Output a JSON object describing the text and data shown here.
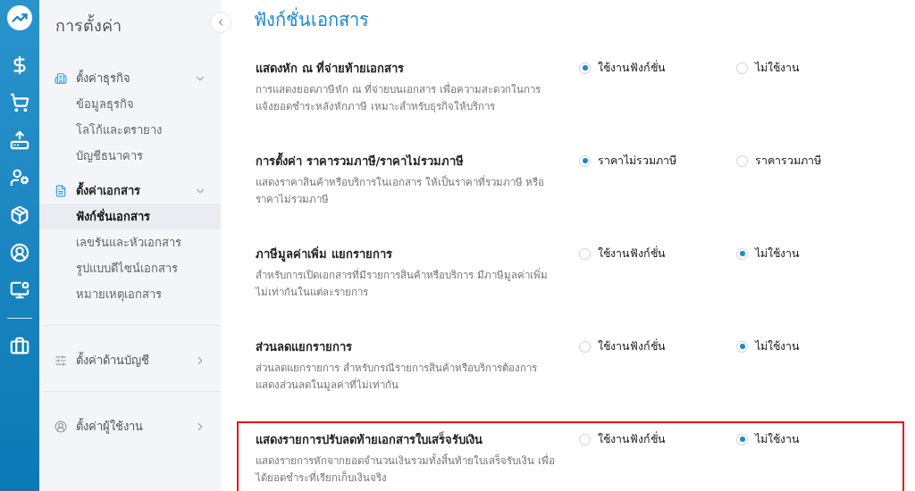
{
  "rail": {
    "items": [
      {
        "kind": "money"
      },
      {
        "kind": "cart"
      },
      {
        "kind": "upload"
      },
      {
        "kind": "contacts"
      },
      {
        "kind": "box"
      },
      {
        "kind": "user"
      },
      {
        "kind": "monitor"
      },
      {
        "kind": "divider"
      },
      {
        "kind": "briefcase"
      }
    ]
  },
  "sidebar": {
    "title": "การตั้งค่า",
    "groups": [
      {
        "label": "ตั้งค่าธุรกิจ",
        "kind": "building",
        "expanded": true,
        "children": [
          {
            "label": "ข้อมูลธุรกิจ",
            "selected": false
          },
          {
            "label": "โลโก้และตรายาง",
            "selected": false
          },
          {
            "label": "บัญชีธนาคาร",
            "selected": false
          }
        ]
      },
      {
        "label": "ตั้งค่าเอกสาร",
        "kind": "document",
        "expanded": true,
        "children": [
          {
            "label": "ฟังก์ชั่นเอกสาร",
            "selected": true
          },
          {
            "label": "เลขรันและหัวเอกสาร",
            "selected": false
          },
          {
            "label": "รูปแบบดีไซน์เอกสาร",
            "selected": false
          },
          {
            "label": "หมายเหตุเอกสาร",
            "selected": false
          }
        ]
      },
      {
        "label": "ตั้งค่าด้านบัญชี",
        "kind": "sliders",
        "expanded": false
      },
      {
        "label": "ตั้งค่าผู้ใช้งาน",
        "kind": "user",
        "expanded": false
      }
    ]
  },
  "page": {
    "title": "ฟังก์ชั่นเอกสาร",
    "settings": [
      {
        "title": "แสดงหัก ณ ที่จ่ายท้ายเอกสาร",
        "description": "การแสดงยอดภาษีหัก ณ ที่จ่ายบนเอกสาร เพื่อความสะดวกในการแจ้งยอดชำระหลังหักภาษี เหมาะสำหรับธุรกิจให้บริการ",
        "highlighted": false,
        "options": [
          {
            "label": "ใช้งานฟังก์ชั่น",
            "selected": true
          },
          {
            "label": "ไม่ใช้งาน",
            "selected": false
          }
        ]
      },
      {
        "title": "การตั้งค่า ราคารวมภาษี/ราคาไม่รวมภาษี",
        "description": "แสดงราคาสินค้าหรือบริการในเอกสาร ให้เป็นราคาที่รวมภาษี หรือราคาไม่รวมภาษี",
        "highlighted": false,
        "options": [
          {
            "label": "ราคาไม่รวมภาษี",
            "selected": true
          },
          {
            "label": "ราคารวมภาษี",
            "selected": false
          }
        ]
      },
      {
        "title": "ภาษีมูลค่าเพิ่ม แยกรายการ",
        "description": "สำหรับการเปิดเอกสารที่มีรายการสินค้าหรือบริการ มีภาษีมูลค่าเพิ่มไม่เท่ากันในแต่ละรายการ",
        "highlighted": false,
        "options": [
          {
            "label": "ใช้งานฟังก์ชั่น",
            "selected": false
          },
          {
            "label": "ไม่ใช้งาน",
            "selected": true
          }
        ]
      },
      {
        "title": "ส่วนลดแยกรายการ",
        "description": "ส่วนลดแยกรายการ สำหรับกรณีรายการสินค้าหรือบริการต้องการแสดงส่วนลดในมูลค่าที่ไม่เท่ากัน",
        "highlighted": false,
        "options": [
          {
            "label": "ใช้งานฟังก์ชั่น",
            "selected": false
          },
          {
            "label": "ไม่ใช้งาน",
            "selected": true
          }
        ]
      },
      {
        "title": "แสดงรายการปรับลดท้ายเอกสารใบเสร็จรับเงิน",
        "description": "แสดงรายการหักจากยอดจำนวนเงินรวมทั้งสิ้นท้ายใบเสร็จรับเงิน เพื่อได้ยอดชำระที่เรียกเก็บเงินจริง",
        "highlighted": true,
        "options": [
          {
            "label": "ใช้งานฟังก์ชั่น",
            "selected": false
          },
          {
            "label": "ไม่ใช้งาน",
            "selected": true
          }
        ]
      }
    ]
  }
}
